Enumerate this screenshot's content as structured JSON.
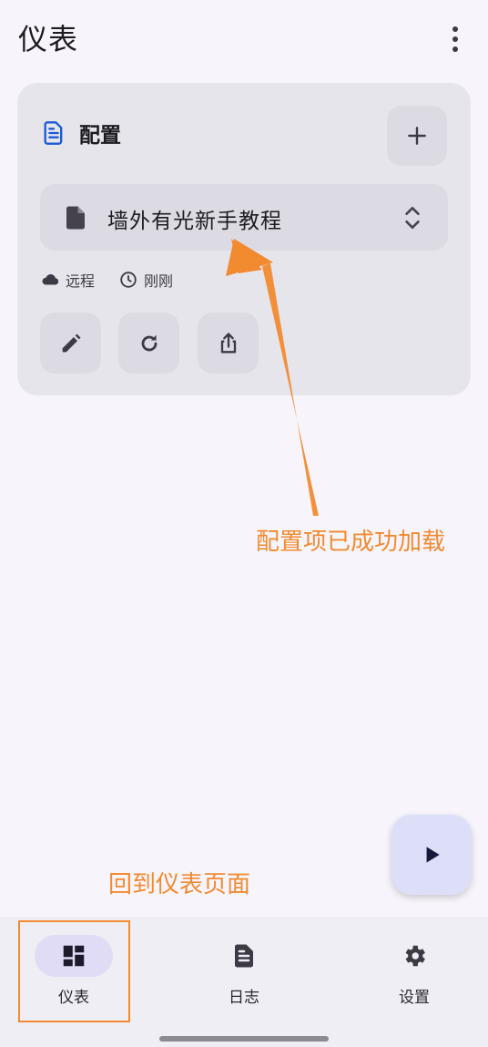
{
  "header": {
    "title": "仪表",
    "more_icon": "more-vert-icon"
  },
  "config_card": {
    "title": "配置",
    "title_icon": "document-icon",
    "add_icon": "plus-icon",
    "profile": {
      "name": "墙外有光新手教程",
      "icon": "file-icon",
      "selector_icon": "unfold-icon"
    },
    "meta": {
      "type_label": "远程",
      "type_icon": "cloud-icon",
      "time_label": "刚刚",
      "time_icon": "clock-icon"
    },
    "actions": [
      {
        "icon": "edit-icon"
      },
      {
        "icon": "refresh-icon"
      },
      {
        "icon": "share-icon"
      }
    ]
  },
  "annotations": {
    "loaded_note": "配置项已成功加载",
    "back_note": "回到仪表页面",
    "color": "#f28a30"
  },
  "fab": {
    "icon": "play-icon"
  },
  "bottom_nav": {
    "items": [
      {
        "label": "仪表",
        "icon": "dashboard-icon",
        "active": true
      },
      {
        "label": "日志",
        "icon": "log-icon",
        "active": false
      },
      {
        "label": "设置",
        "icon": "gear-icon",
        "active": false
      }
    ]
  },
  "colors": {
    "accent": "#1a5bd6",
    "background": "#f7f5fb",
    "card": "#e6e5ec"
  }
}
